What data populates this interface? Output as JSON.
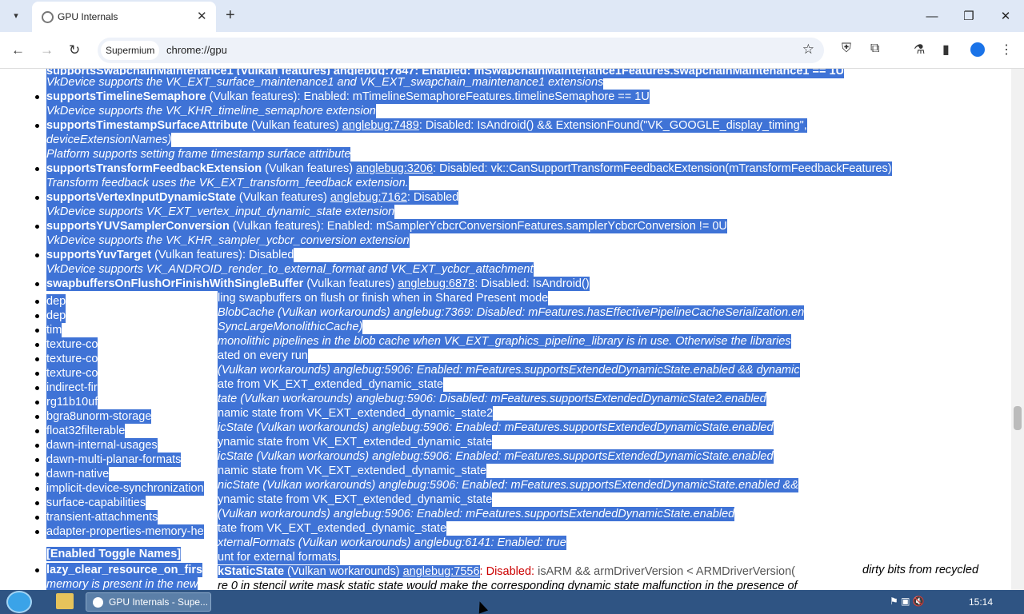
{
  "browser": {
    "tab_title": "GPU Internals",
    "new_tab": "+",
    "omnibox_chip": "Supermium",
    "url": "chrome://gpu"
  },
  "taskbar": {
    "app_label": "GPU Internals - Supe...",
    "clock": "15:14"
  },
  "lines": [
    {
      "t": "supportsSwapchainMaintenance1 (Vulkan features) anglebug:7847: Enabled: mSwapchainMaintenance1Features.swapchainMaintenance1 == 1U"
    },
    {
      "t": "VkDevice supports the VK_EXT_surface_maintenance1 and VK_EXT_swapchain_maintenance1 extensions"
    },
    {
      "n": "supportsTimelineSemaphore",
      "r": " (Vulkan features): Enabled: mTimelineSemaphoreFeatures.timelineSemaphore == 1U"
    },
    {
      "t": "VkDevice supports the VK_KHR_timeline_semaphore extension"
    },
    {
      "n": "supportsTimestampSurfaceAttribute",
      "m": " (Vulkan features) ",
      "l": "anglebug:7489",
      "r": ": Disabled: IsAndroid() && ExtensionFound(\"VK_GOOGLE_display_timing\","
    },
    {
      "t": "deviceExtensionNames)"
    },
    {
      "t": "Platform supports setting frame timestamp surface attribute"
    },
    {
      "n": "supportsTransformFeedbackExtension",
      "m": " (Vulkan features) ",
      "l": "anglebug:3206",
      "r": ": Disabled: vk::CanSupportTransformFeedbackExtension(mTransformFeedbackFeatures)"
    },
    {
      "t": "Transform feedback uses the VK_EXT_transform_feedback extension."
    },
    {
      "n": "supportsVertexInputDynamicState",
      "m": " (Vulkan features) ",
      "l": "anglebug:7162",
      "r": ": Disabled"
    },
    {
      "t": "VkDevice supports VK_EXT_vertex_input_dynamic_state extension"
    },
    {
      "n": "supportsYUVSamplerConversion",
      "r": " (Vulkan features): Enabled: mSamplerYcbcrConversionFeatures.samplerYcbcrConversion != 0U"
    },
    {
      "t": "VkDevice supports the VK_KHR_sampler_ycbcr_conversion extension"
    },
    {
      "n": "supportsYuvTarget",
      "r": " (Vulkan features): Disabled"
    },
    {
      "t": "VkDevice supports VK_ANDROID_render_to_external_format and VK_EXT_ycbcr_attachment"
    },
    {
      "n": "swapbuffersOnFlushOrFinishWithSingleBuffer",
      "m": " (Vulkan features) ",
      "l": "anglebug:6878",
      "r": ": Disabled: IsAndroid()"
    }
  ],
  "right_lines": [
    {
      "t": "ling swapbuffers on flush or finish when in Shared Present mode"
    },
    {
      "t": "BlobCache (Vulkan workarounds) anglebug:7369: Disabled: mFeatures.hasEffectivePipelineCacheSerialization.en"
    },
    {
      "t": "SyncLargeMonolithicCache)"
    },
    {
      "t": "monolithic pipelines in the blob cache when VK_EXT_graphics_pipeline_library is in use. Otherwise the libraries"
    },
    {
      "t": "ated on every run"
    },
    {
      "t": "(Vulkan workarounds) anglebug:5906: Enabled: mFeatures.supportsExtendedDynamicState.enabled && dynamic"
    },
    {
      "t": "ate from VK_EXT_extended_dynamic_state"
    },
    {
      "t": "tate (Vulkan workarounds) anglebug:5906: Disabled: mFeatures.supportsExtendedDynamicState2.enabled"
    },
    {
      "t": "namic state from VK_EXT_extended_dynamic_state2"
    },
    {
      "t": "icState (Vulkan workarounds) anglebug:5906: Enabled: mFeatures.supportsExtendedDynamicState.enabled"
    },
    {
      "t": "ynamic state from VK_EXT_extended_dynamic_state"
    },
    {
      "t": "icState (Vulkan workarounds) anglebug:5906: Enabled: mFeatures.supportsExtendedDynamicState.enabled"
    },
    {
      "t": "namic state from VK_EXT_extended_dynamic_state"
    },
    {
      "t": "nicState (Vulkan workarounds) anglebug:5906: Enabled: mFeatures.supportsExtendedDynamicState.enabled &&"
    },
    {
      "t": "ynamic state from VK_EXT_extended_dynamic_state"
    },
    {
      "t": "(Vulkan workarounds) anglebug:5906: Enabled: mFeatures.supportsExtendedDynamicState.enabled"
    },
    {
      "t": "tate from VK_EXT_extended_dynamic_state"
    },
    {
      "t": "xternalFormats (Vulkan workarounds) anglebug:6141: Enabled: true"
    },
    {
      "t": "unt for external formats."
    }
  ],
  "left_list": [
    "dep",
    "dep",
    "tim",
    "texture-co",
    "texture-co",
    "texture-co",
    "indirect-fir",
    "rg11b10uf",
    "bgra8unorm-storage",
    "float32filterable",
    "dawn-internal-usages",
    "dawn-multi-planar-formats",
    "dawn-native",
    "implicit-device-synchronization",
    "surface-capabilities",
    "transient-attachments",
    "adapter-properties-memory-he"
  ],
  "toggle_heading": "[Enabled Toggle Names]",
  "bottom": {
    "lazy": "lazy_clear_resource_on_firs",
    "mem": "memory is present in the new",
    "state_name": "kStaticState",
    "wa": " (Vulkan workarounds) ",
    "link": "anglebug:7556",
    "disabled": ": Disabled:",
    "cond": " isARM && armDriverVersion < ARMDriverVersion(",
    "dirty": "dirty bits from recycled",
    "last": "re 0 in stencil write mask static state would make the corresponding dynamic state malfunction in the presence of"
  }
}
